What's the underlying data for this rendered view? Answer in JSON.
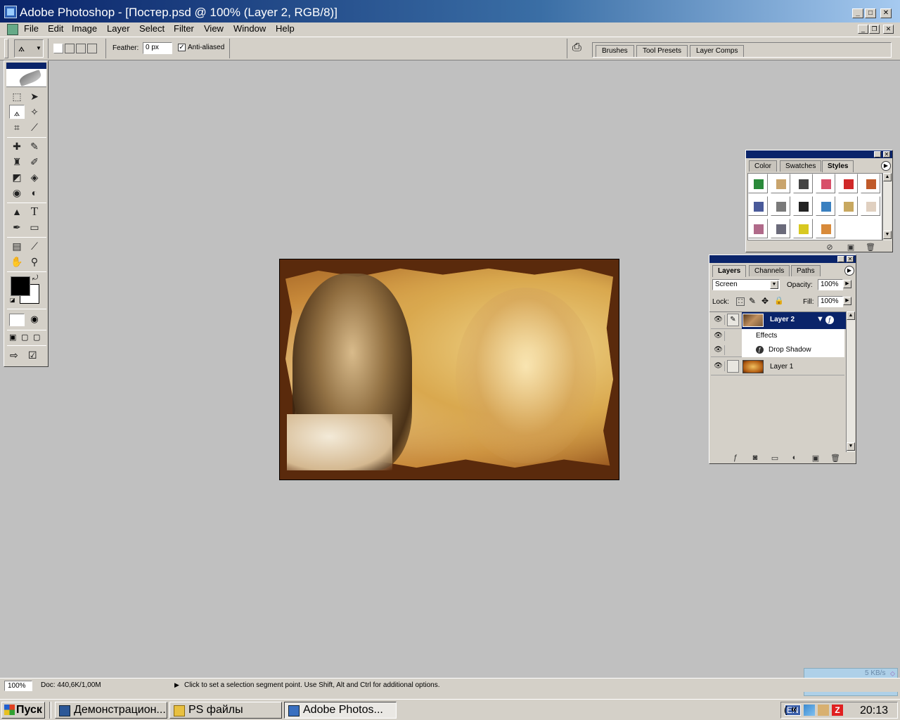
{
  "window": {
    "title": "Adobe Photoshop - [Постер.psd @ 100% (Layer 2, RGB/8)]",
    "minimize": "_",
    "maximize": "□",
    "close": "✕",
    "doc_minimize": "_",
    "doc_restore": "❐",
    "doc_close": "✕"
  },
  "menu": [
    "File",
    "Edit",
    "Image",
    "Layer",
    "Select",
    "Filter",
    "View",
    "Window",
    "Help"
  ],
  "options": {
    "feather_label": "Feather:",
    "feather_value": "0 px",
    "antialias_label": "Anti-aliased",
    "antialias_checked": "✓",
    "palette_well_tabs": [
      "Brushes",
      "Tool Presets",
      "Layer Comps"
    ]
  },
  "tools": {
    "foreground_color": "#000000",
    "background_color": "#ffffff"
  },
  "styles_palette": {
    "tabs": [
      "Color",
      "Swatches",
      "Styles"
    ],
    "active_tab": "Styles",
    "swatches": [
      "#2a8a3a",
      "#c9a46c",
      "#444444",
      "#d8506a",
      "#d02828",
      "#c05a2a",
      "#4a5a9a",
      "#7a7a7a",
      "#222222",
      "#3a80c0",
      "#c8a860",
      "#e0d0c0",
      "#b06a8a",
      "#6a6a7a",
      "#d8c820",
      "#d88a3a"
    ]
  },
  "layers_palette": {
    "tabs": [
      "Layers",
      "Channels",
      "Paths"
    ],
    "active_tab": "Layers",
    "blend_mode": "Screen",
    "opacity_label": "Opacity:",
    "opacity_value": "100%",
    "lock_label": "Lock:",
    "fill_label": "Fill:",
    "fill_value": "100%",
    "layers": [
      {
        "name": "Layer 2",
        "selected": true
      },
      {
        "name": "Effects",
        "type": "effects-header"
      },
      {
        "name": "Drop Shadow",
        "type": "effect"
      },
      {
        "name": "Layer 1",
        "selected": false
      }
    ]
  },
  "status": {
    "zoom": "100%",
    "doc": "Doc: 440,6K/1,00M",
    "hint": "Click to set a selection segment point.  Use Shift, Alt and Ctrl for additional options."
  },
  "network": {
    "speed": "5 KB/s"
  },
  "taskbar": {
    "start": "Пуск",
    "buttons": [
      {
        "label": "Демонстрацион...",
        "icon_color": "#2b5797",
        "active": false
      },
      {
        "label": "PS файлы",
        "icon_color": "#e8c040",
        "active": false
      },
      {
        "label": "Adobe Photos...",
        "icon_color": "#3a70c0",
        "active": true
      }
    ],
    "lang": "EN",
    "time": "20:13"
  }
}
